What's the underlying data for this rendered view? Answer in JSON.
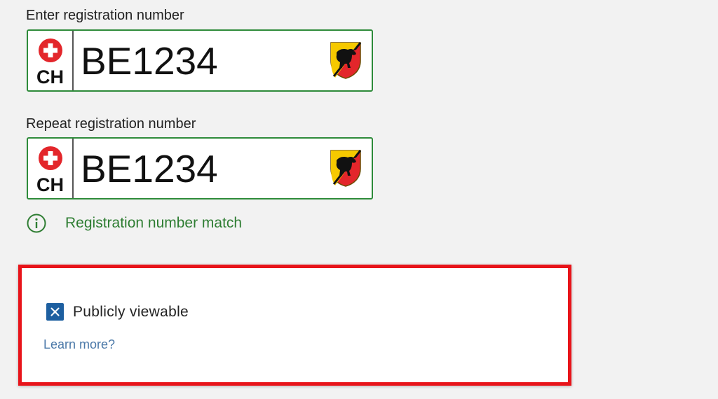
{
  "registration": {
    "enter_label": "Enter registration number",
    "repeat_label": "Repeat registration number",
    "country_code": "CH",
    "value": "BE1234",
    "repeat_value": "BE1234",
    "valid_color": "#2e8b3a"
  },
  "match_message": {
    "icon": "info-circle-icon",
    "text": "Registration number match",
    "color": "#2e7d32"
  },
  "visibility": {
    "checkbox_label": "Publicly viewable",
    "checked": true,
    "learn_more": "Learn more?",
    "highlight_color": "#e8141a"
  },
  "icons": {
    "flag": "swiss-cross-icon",
    "canton": "bern-coat-of-arms-icon",
    "checkbox": "checkbox-x-icon"
  }
}
